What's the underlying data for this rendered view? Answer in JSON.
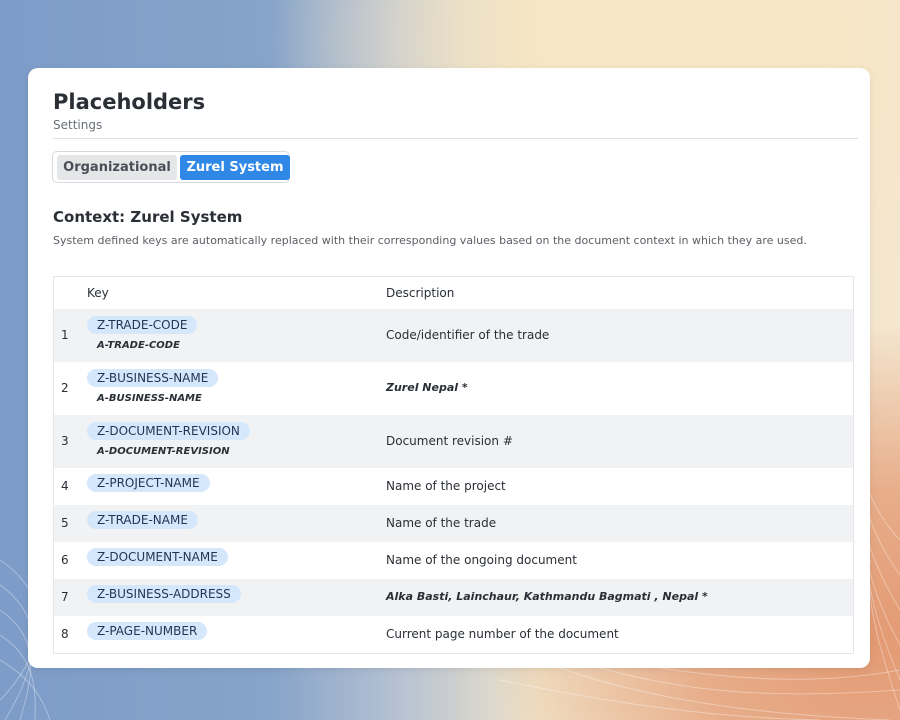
{
  "header": {
    "title": "Placeholders",
    "subtitle": "Settings"
  },
  "tabs": [
    {
      "label": "Organizational",
      "active": false
    },
    {
      "label": "Zurel System",
      "active": true
    }
  ],
  "context": {
    "title": "Context: Zurel System",
    "description": "System defined keys are automatically replaced with their corresponding values based on the document context in which they are used."
  },
  "table": {
    "columns": [
      "Key",
      "Description"
    ],
    "rows": [
      {
        "num": "1",
        "key": "Z-TRADE-CODE",
        "alias": "A-TRADE-CODE",
        "description": "Code/identifier of the trade",
        "desc_italic": false
      },
      {
        "num": "2",
        "key": "Z-BUSINESS-NAME",
        "alias": "A-BUSINESS-NAME",
        "description": "Zurel Nepal *",
        "desc_italic": true
      },
      {
        "num": "3",
        "key": "Z-DOCUMENT-REVISION",
        "alias": "A-DOCUMENT-REVISION",
        "description": "Document revision #",
        "desc_italic": false
      },
      {
        "num": "4",
        "key": "Z-PROJECT-NAME",
        "alias": "",
        "description": "Name of the project",
        "desc_italic": false
      },
      {
        "num": "5",
        "key": "Z-TRADE-NAME",
        "alias": "",
        "description": "Name of the trade",
        "desc_italic": false
      },
      {
        "num": "6",
        "key": "Z-DOCUMENT-NAME",
        "alias": "",
        "description": "Name of the ongoing document",
        "desc_italic": false
      },
      {
        "num": "7",
        "key": "Z-BUSINESS-ADDRESS",
        "alias": "",
        "description": "Alka Basti, Lainchaur, Kathmandu Bagmati , Nepal *",
        "desc_italic": true
      },
      {
        "num": "8",
        "key": "Z-PAGE-NUMBER",
        "alias": "",
        "description": "Current page number of the document",
        "desc_italic": false
      }
    ]
  },
  "colors": {
    "accent": "#2f88e6",
    "chip_bg": "#d5e7fb",
    "row_shade": "#f1f2f4"
  }
}
